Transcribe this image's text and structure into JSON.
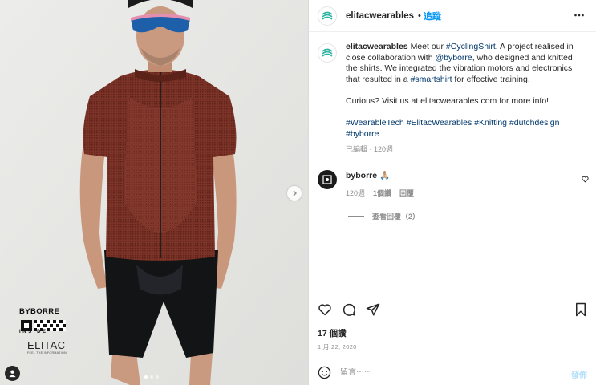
{
  "photo": {
    "brand_top": "BYBORRE",
    "brand_inside": "INSIDE",
    "brand_bottom": "ELITAC",
    "brand_tagline": "FEEL THE INFORMATION",
    "carousel": {
      "slides": 3,
      "active": 1
    },
    "icons": {
      "next": "chevron-right-icon",
      "user_tag": "person-icon"
    }
  },
  "header": {
    "username": "elitacwearables",
    "separator": "•",
    "follow_label": "追蹤",
    "more_icon": "more-horizontal-icon"
  },
  "caption": {
    "username": "elitacwearables",
    "text_1": "Meet our ",
    "tag_1": "#CyclingShirt",
    "text_2": ". A project realised in close collaboration with ",
    "mention": "@byborre",
    "text_3": ", who designed and knitted the shirts. We integrated the vibration motors and electronics that resulted in a ",
    "tag_2": "#smartshirt",
    "text_4": " for effective training.",
    "paragraph_2": "Curious? Visit us at elitacwearables.com for more info!",
    "tags": [
      "#WearableTech",
      "#ElitacWearables",
      "#Knitting",
      "#dutchdesign",
      "#byborre"
    ],
    "meta": "已編輯 · 120週"
  },
  "comment": {
    "username": "byborre",
    "text": "🙏🏼",
    "age": "120週",
    "likes": "1個讚",
    "reply": "回覆",
    "view_replies": "查看回覆（2）",
    "heart_icon": "heart-outline-icon"
  },
  "actions": {
    "icons": [
      "heart-icon",
      "comment-icon",
      "share-icon",
      "bookmark-icon"
    ],
    "likes": "17 個讚",
    "date": "1 月 22, 2020"
  },
  "comment_bar": {
    "emoji_icon": "smile-icon",
    "placeholder": "留言⋯⋯",
    "post_label": "發佈"
  },
  "colors": {
    "accent": "#0095f6",
    "link": "#00376b",
    "muted": "#8e8e8e",
    "jersey": "#7a3528",
    "logo_teal": "#2fb3a3"
  }
}
